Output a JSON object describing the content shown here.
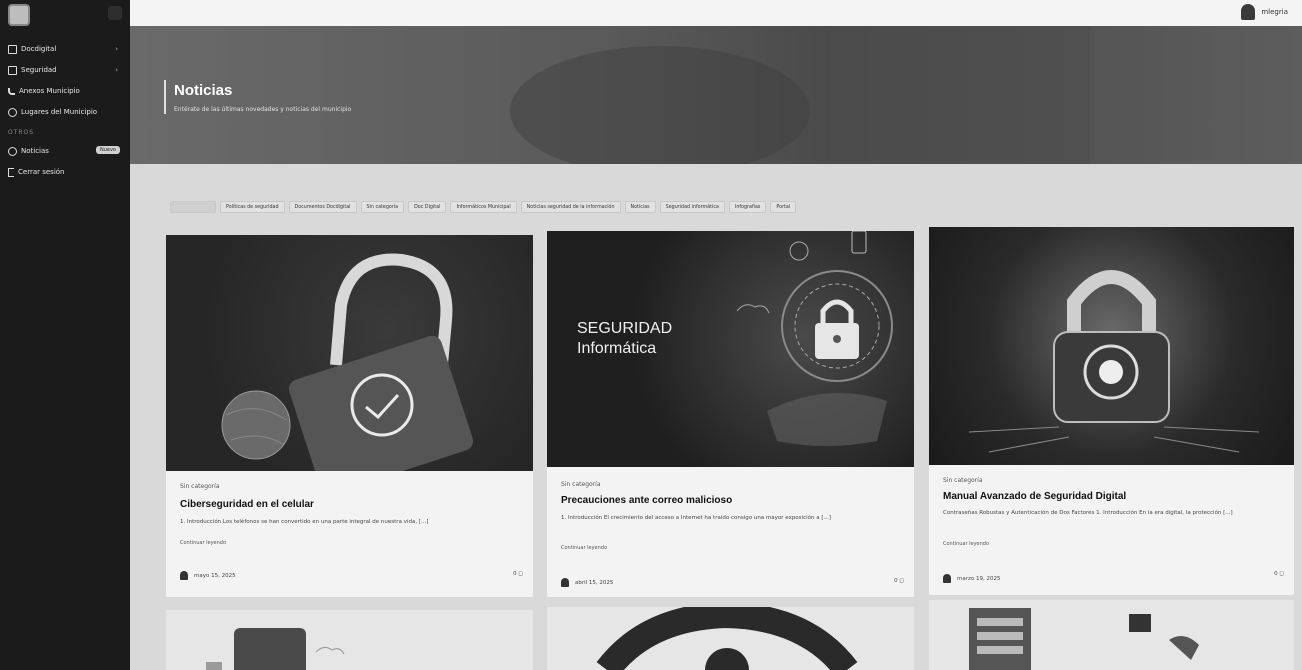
{
  "sidebar": {
    "items": [
      {
        "label": "Docdigital",
        "icon": "document-icon",
        "chevron": "›"
      },
      {
        "label": "Seguridad",
        "icon": "document-icon",
        "chevron": "›"
      },
      {
        "label": "Anexos Municipio",
        "icon": "phone-icon"
      },
      {
        "label": "Lugares del Municipio",
        "icon": "location-icon"
      }
    ],
    "section_label": "OTROS",
    "other_items": [
      {
        "label": "Noticias",
        "icon": "info-icon",
        "badge": "Nuevo"
      },
      {
        "label": "Cerrar sesión",
        "icon": "logout-icon"
      }
    ]
  },
  "topbar": {
    "username": "mlegria"
  },
  "hero": {
    "title": "Noticias",
    "subtitle": "Entérate de las últimas novedades y noticias del municipio"
  },
  "chips": [
    "",
    "Políticas de seguridad",
    "Documentos Docdigital",
    "Sin categoría",
    "Doc Digital",
    "Informáticos Municipal",
    "Noticias seguridad de la información",
    "Noticias",
    "Seguridad informática",
    "Infografías",
    "Portal"
  ],
  "cards": [
    {
      "category": "Sin categoría",
      "title": "Ciberseguridad en el celular",
      "excerpt": "1. Introducción Los teléfonos se han convertido en una parte integral de nuestra vida, [...]",
      "more": "Continuar leyendo",
      "date": "mayo 15, 2025",
      "comments": "0 ◻"
    },
    {
      "category": "Sin categoría",
      "title": "Precauciones ante correo malicioso",
      "excerpt": "1. Introducción El crecimiento del acceso a Internet ha traído consigo una mayor exposición a [...]",
      "more": "Continuar leyendo",
      "date": "abril 15, 2025",
      "comments": "0 ◻",
      "image_text_1": "SEGURIDAD",
      "image_text_2": "Informática"
    },
    {
      "category": "Sin categoría",
      "title": "Manual Avanzado de Seguridad Digital",
      "excerpt": "Contraseñas Robustas y Autenticación de Dos Factores 1. Introducción En la era digital, la protección [...]",
      "more": "Continuar leyendo",
      "date": "marzo 19, 2025",
      "comments": "0 ◻"
    }
  ]
}
